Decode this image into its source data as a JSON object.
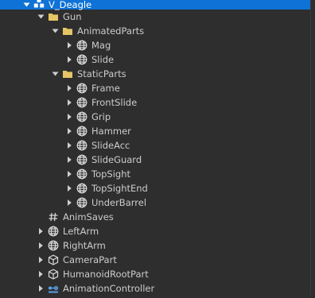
{
  "explorer": {
    "items": [
      {
        "label": "V_Deagle",
        "icon": "model-icon",
        "depth": 0,
        "arrow": "down",
        "selected": true
      },
      {
        "label": "Gun",
        "icon": "folder-icon",
        "depth": 1,
        "arrow": "down"
      },
      {
        "label": "AnimatedParts",
        "icon": "folder-icon",
        "depth": 2,
        "arrow": "down"
      },
      {
        "label": "Mag",
        "icon": "meshpart-icon",
        "depth": 3,
        "arrow": "right"
      },
      {
        "label": "Slide",
        "icon": "meshpart-icon",
        "depth": 3,
        "arrow": "right"
      },
      {
        "label": "StaticParts",
        "icon": "folder-icon",
        "depth": 2,
        "arrow": "down"
      },
      {
        "label": "Frame",
        "icon": "meshpart-icon",
        "depth": 3,
        "arrow": "right"
      },
      {
        "label": "FrontSlide",
        "icon": "meshpart-icon",
        "depth": 3,
        "arrow": "right"
      },
      {
        "label": "Grip",
        "icon": "meshpart-icon",
        "depth": 3,
        "arrow": "right"
      },
      {
        "label": "Hammer",
        "icon": "meshpart-icon",
        "depth": 3,
        "arrow": "right"
      },
      {
        "label": "SlideAcc",
        "icon": "meshpart-icon",
        "depth": 3,
        "arrow": "right"
      },
      {
        "label": "SlideGuard",
        "icon": "meshpart-icon",
        "depth": 3,
        "arrow": "right"
      },
      {
        "label": "TopSight",
        "icon": "meshpart-icon",
        "depth": 3,
        "arrow": "right"
      },
      {
        "label": "TopSightEnd",
        "icon": "meshpart-icon",
        "depth": 3,
        "arrow": "right"
      },
      {
        "label": "UnderBarrel",
        "icon": "meshpart-icon",
        "depth": 3,
        "arrow": "right"
      },
      {
        "label": "AnimSaves",
        "icon": "numbervalue-icon",
        "depth": 1,
        "arrow": "none"
      },
      {
        "label": "LeftArm",
        "icon": "meshpart-icon",
        "depth": 1,
        "arrow": "right"
      },
      {
        "label": "RightArm",
        "icon": "meshpart-icon",
        "depth": 1,
        "arrow": "right"
      },
      {
        "label": "CameraPart",
        "icon": "part-icon",
        "depth": 1,
        "arrow": "right"
      },
      {
        "label": "HumanoidRootPart",
        "icon": "part-icon",
        "depth": 1,
        "arrow": "right"
      },
      {
        "label": "AnimationController",
        "icon": "animationcontroller-icon",
        "depth": 1,
        "arrow": "right"
      }
    ]
  },
  "colors": {
    "background": "#2e2e2e",
    "selection": "#0e72d6",
    "text": "#cccccc",
    "folder": "#e6c567",
    "icon_light": "#d8d8d8",
    "anim_blue": "#5aa0e8"
  }
}
